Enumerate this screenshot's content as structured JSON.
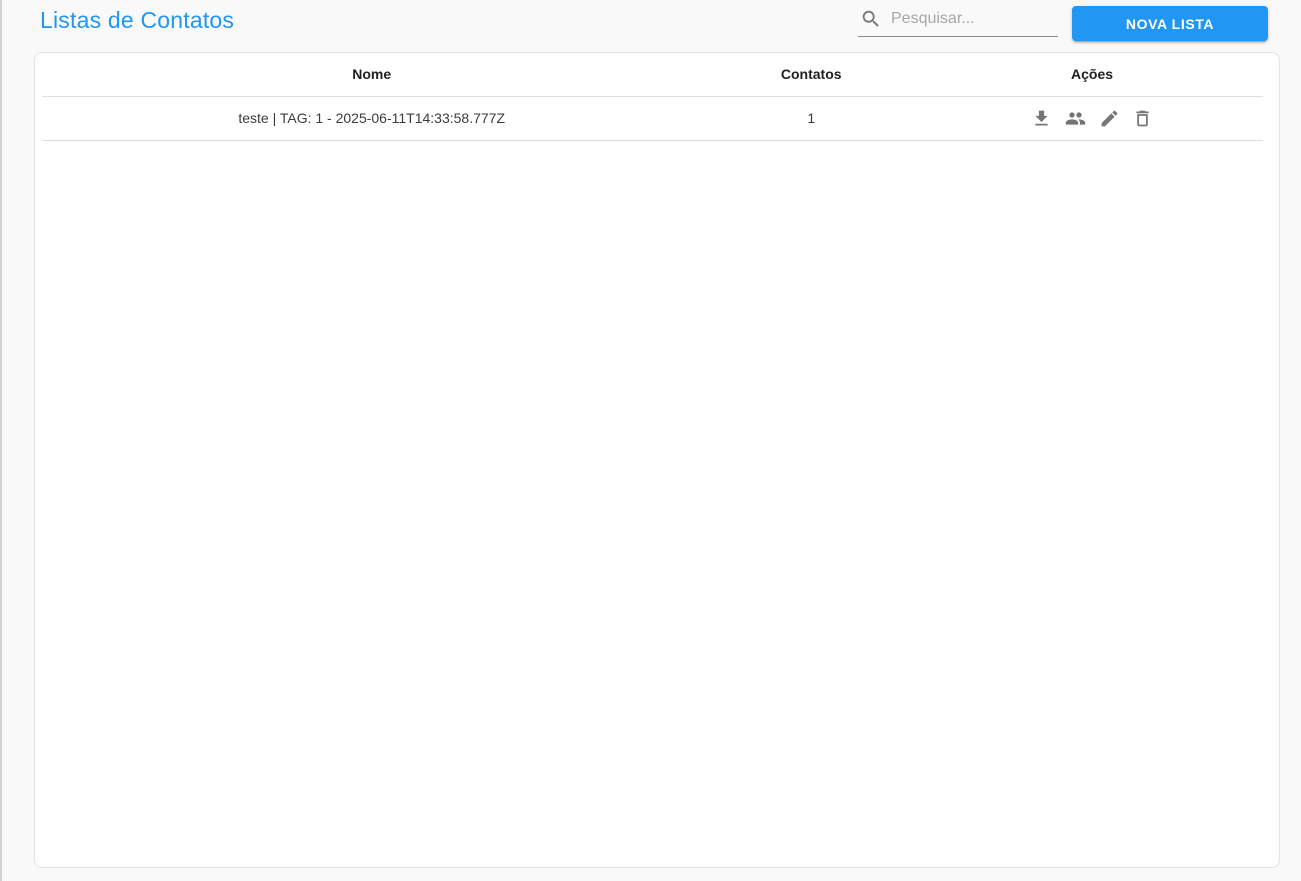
{
  "page": {
    "title": "Listas de Contatos"
  },
  "search": {
    "placeholder": "Pesquisar..."
  },
  "toolbar": {
    "new_list_label": "NOVA LISTA"
  },
  "table": {
    "columns": [
      {
        "label": "Nome"
      },
      {
        "label": "Contatos"
      },
      {
        "label": "Ações"
      }
    ],
    "rows": [
      {
        "name": "teste | TAG: 1 - 2025-06-11T14:33:58.777Z",
        "contacts": "1",
        "actions": [
          {
            "icon": "download-icon"
          },
          {
            "icon": "people-icon"
          },
          {
            "icon": "edit-icon"
          },
          {
            "icon": "delete-icon"
          }
        ]
      }
    ]
  },
  "colors": {
    "accent": "#2196f3",
    "icon_gray": "#757575",
    "page_background": "#f9f9f9"
  }
}
